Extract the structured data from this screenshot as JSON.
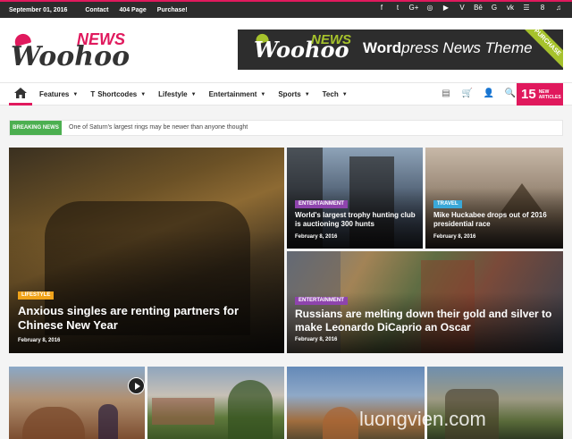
{
  "topbar": {
    "date": "September 01, 2016",
    "links": [
      "Contact",
      "404 Page",
      "Purchase!"
    ],
    "social": [
      "f",
      "t",
      "G+",
      "◎",
      "▶",
      "V",
      "Bē",
      "G",
      "vk",
      "☰",
      "8",
      "♫"
    ]
  },
  "logo": {
    "main": "Woohoo",
    "accent": "NEWS"
  },
  "banner": {
    "logo_main": "Woohoo",
    "logo_accent": "NEWS",
    "tagline_bold": "Word",
    "tagline_rest": "press News Theme",
    "ribbon": "PURCHASE"
  },
  "nav": {
    "items": [
      {
        "label": "Features",
        "has_dropdown": true
      },
      {
        "label": "Shortcodes",
        "has_dropdown": true
      },
      {
        "label": "Lifestyle",
        "has_dropdown": true
      },
      {
        "label": "Entertainment",
        "has_dropdown": true
      },
      {
        "label": "Sports",
        "has_dropdown": true
      },
      {
        "label": "Tech",
        "has_dropdown": true
      }
    ],
    "new_count": "15",
    "new_label_1": "NEW",
    "new_label_2": "ARTICLES",
    "icons": [
      "news-icon",
      "cart-icon",
      "user-icon",
      "search-icon"
    ]
  },
  "breaking": {
    "label": "BREAKING NEWS",
    "text": "One of Saturn's largest rings may be newer than anyone thought"
  },
  "featured": [
    {
      "category": "LIFESTYLE",
      "category_color": "#f0a31a",
      "title": "Anxious singles are renting partners for Chinese New Year",
      "date": "February 8, 2016"
    },
    {
      "category": "ENTERTAINMENT",
      "category_color": "#8e44ad",
      "title": "World's largest trophy hunting club is auctioning 300 hunts",
      "date": "February 8, 2016"
    },
    {
      "category": "TRAVEL",
      "category_color": "#3aa8d8",
      "title": "Mike Huckabee drops out of 2016 presidential race",
      "date": "February 8, 2016"
    },
    {
      "category": "ENTERTAINMENT",
      "category_color": "#8e44ad",
      "title": "Russians are melting down their gold and silver to make Leonardo DiCaprio an Oscar",
      "date": "February 8, 2016"
    }
  ],
  "watermark": "luongvien.com",
  "colors": {
    "accent": "#e0195d",
    "breaking": "#4caf50"
  }
}
